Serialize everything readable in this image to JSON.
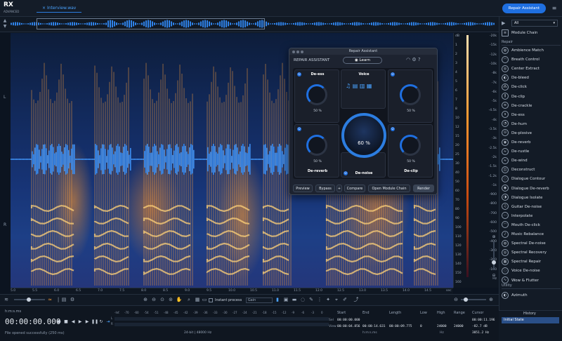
{
  "app": {
    "logo": "RX",
    "logo_sub": "ADVANCED",
    "tab": "Interview.wav",
    "repair_assistant_btn": "Repair Assistant",
    "menu_icon": "hamburger-icon"
  },
  "channels": {
    "left": "L",
    "right": "R"
  },
  "scale": {
    "db": [
      "dB",
      "1",
      "2",
      "3",
      "4",
      "5",
      "6",
      "7",
      "8",
      "10",
      "12",
      "15",
      "20",
      "25",
      "30",
      "40",
      "50",
      "60",
      "70",
      "80",
      "90",
      "100",
      "110",
      "120",
      "130",
      "140",
      "150",
      "160"
    ],
    "hz": [
      "-20k",
      "-15k",
      "-12k",
      "-10k",
      "-8k",
      "-7k",
      "-6k",
      "-5k",
      "-4.5k",
      "-4k",
      "-3.5k",
      "-3k",
      "-2.5k",
      "-2k",
      "-1.5k",
      "-1.2k",
      "-1k",
      "-900",
      "-800",
      "-700",
      "-600",
      "-500",
      "-400",
      "-300",
      "-200",
      "-100",
      "Hz"
    ],
    "right_db": [
      "-20",
      "-30",
      "-40",
      "-50",
      "-60",
      "-70",
      "-80",
      "-90",
      "-100",
      "-110",
      "-120",
      "-130"
    ]
  },
  "ruler": [
    "5.0",
    "5.5",
    "6.0",
    "6.5",
    "7.0",
    "7.5",
    "8.0",
    "8.5",
    "9.0",
    "9.5",
    "10.0",
    "10.5",
    "11.0",
    "11.5",
    "12.0",
    "12.5",
    "13.0",
    "13.5",
    "14.0",
    "14.5",
    "sec"
  ],
  "toolbar": {
    "instant_process": "Instant process",
    "gain": "Gain"
  },
  "transport": {
    "format": "h:m:s.ms",
    "timecode": "00:00:00.000",
    "status": "File opened successfully (250 ms)"
  },
  "meter": {
    "labels": [
      "-Inf.",
      "-70",
      "-60",
      "-54",
      "-51",
      "-48",
      "-45",
      "-42",
      "-39",
      "-36",
      "-33",
      "-30",
      "-27",
      "-24",
      "-21",
      "-18",
      "-15",
      "-12",
      "-9",
      "-6",
      "-3",
      "0"
    ],
    "row_l": "L",
    "row_r": "R",
    "info": "24-bit | 48000 Hz"
  },
  "selection_table": {
    "headers": {
      "start": "Start",
      "end": "End",
      "length": "Length",
      "low": "Low",
      "high": "High",
      "range": "Range",
      "cursor": "Cursor"
    },
    "sel_label": "Sel",
    "view_label": "View",
    "sel": {
      "start": "00:00:00.000",
      "end": "",
      "length": "",
      "low": "",
      "high": "",
      "range": ""
    },
    "view": {
      "start": "00:00:04.856",
      "end": "00:00:14.631",
      "length": "00:00:09.775",
      "low": "0",
      "high": "24000",
      "range": "24000"
    },
    "cursor": [
      "00:00:11.196",
      "-82.7 dB",
      "3851.2 Hz"
    ],
    "units_left": "h:m:s.ms",
    "units_right": "Hz"
  },
  "repair": {
    "title": "Repair Assistant",
    "header": "REPAIR ASSISTANT",
    "learn": "Learn",
    "modules": [
      {
        "name": "De-ess",
        "pct": "50 %"
      },
      {
        "name": "Voice",
        "pct": ""
      },
      {
        "name": "",
        "pct": "50 %"
      },
      {
        "name": "De-reverb",
        "pct": "50 %"
      },
      {
        "name": "De-noise",
        "pct": "60 %"
      },
      {
        "name": "De-clip",
        "pct": "50 %"
      }
    ],
    "center_pct": "60 %",
    "footer": {
      "preview": "Preview",
      "bypass": "Bypass",
      "plus": "+",
      "compare": "Compare",
      "open_chain": "Open Module Chain",
      "render": "Render"
    }
  },
  "panel": {
    "preset": "All",
    "module_chain": "Module Chain",
    "repair_section": "Repair",
    "items": [
      "Ambience Match",
      "Breath Control",
      "Center Extract",
      "De-bleed",
      "De-click",
      "De-clip",
      "De-crackle",
      "De-ess",
      "De-hum",
      "De-plosive",
      "De-reverb",
      "De-rustle",
      "De-wind",
      "Deconstruct",
      "Dialogue Contour",
      "Dialogue De-reverb",
      "Dialogue Isolate",
      "Guitar De-noise",
      "Interpolate",
      "Mouth De-click",
      "Music Rebalance",
      "Spectral De-noise",
      "Spectral Recovery",
      "Spectral Repair",
      "Voice De-noise",
      "Wow & Flutter"
    ],
    "utility_section": "Utility",
    "utility_items": [
      "Azimuth"
    ],
    "history_title": "History",
    "history_item": "Initial State"
  }
}
